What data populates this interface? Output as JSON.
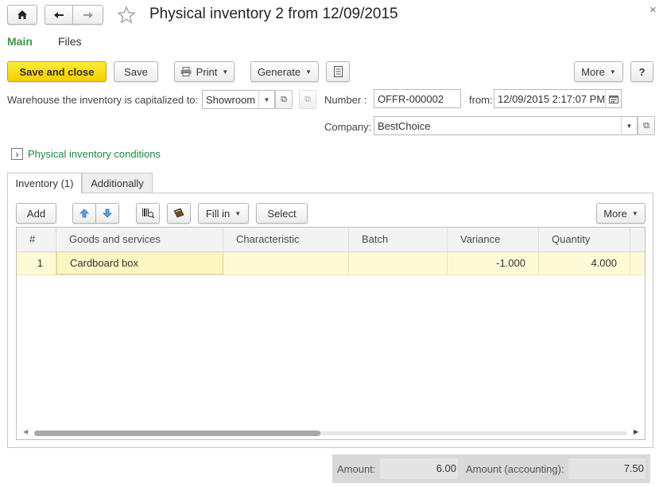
{
  "window": {
    "title": "Physical inventory 2 from 12/09/2015",
    "home_icon": "home-icon",
    "back_icon": "arrow-left-icon",
    "forward_icon": "arrow-right-icon",
    "favorite_icon": "star-icon",
    "close_symbol": "×"
  },
  "tabs": {
    "main": "Main",
    "files": "Files"
  },
  "toolbar": {
    "save_close": "Save and close",
    "save": "Save",
    "print": "Print",
    "generate": "Generate",
    "more": "More",
    "help": "?"
  },
  "form": {
    "warehouse_label": "Warehouse the inventory is capitalized to:",
    "warehouse_value": "Showroom",
    "number_label": "Number :",
    "number_value": "OFFR-000002",
    "from_label": "from:",
    "date_value": "12/09/2015  2:17:07 PM",
    "company_label": "Company:",
    "company_value": "BestChoice"
  },
  "conditions": {
    "label": "Physical inventory conditions",
    "toggle": "›"
  },
  "subtabs": {
    "inventory": "Inventory (1)",
    "additionally": "Additionally"
  },
  "table_toolbar": {
    "add": "Add",
    "fill_in": "Fill in",
    "select": "Select",
    "more": "More"
  },
  "table": {
    "columns": [
      "#",
      "Goods and services",
      "Characteristic",
      "Batch",
      "Variance",
      "Quantity"
    ],
    "rows": [
      {
        "n": "1",
        "goods": "Cardboard box",
        "characteristic": "",
        "batch": "",
        "variance": "-1.000",
        "quantity": "4.000"
      }
    ]
  },
  "totals": {
    "amount_label": "Amount:",
    "amount_value": "6.00",
    "amount_acc_label": "Amount (accounting):",
    "amount_acc_value": "7.50"
  },
  "colors": {
    "accent_green": "#3a9a4e",
    "link_green": "#1d8a3d",
    "primary_yellow": "#f5d20a",
    "row_highlight": "#fdfbd6",
    "totals_bg": "#d9d9d9"
  }
}
